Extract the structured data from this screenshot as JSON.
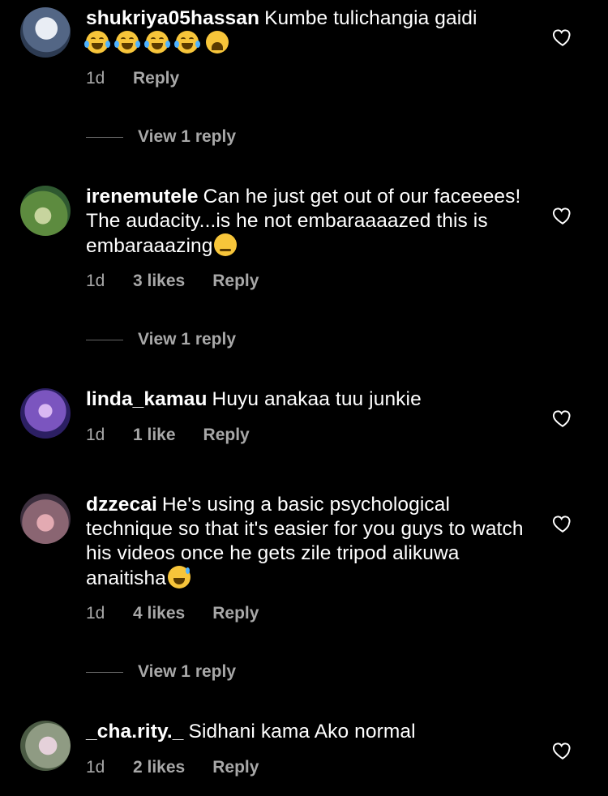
{
  "comments": [
    {
      "username": "shukriya05hassan",
      "text": "Kumbe tulichangia gaidi",
      "emojis": [
        "face-with-tears-of-joy",
        "face-with-tears-of-joy",
        "face-with-tears-of-joy",
        "face-with-tears-of-joy",
        "weary-face"
      ],
      "time": "1d",
      "likes": "",
      "reply": "Reply",
      "view_replies": "View 1 reply",
      "avatar_colors": [
        "#4a5b7b",
        "#c9d4e2"
      ]
    },
    {
      "username": "irenemutele",
      "text": "Can he just get out of our faceeees! The audacity...is he not embaraaaazed this is embaraaazing",
      "emojis": [
        "unamused-face"
      ],
      "time": "1d",
      "likes": "3 likes",
      "reply": "Reply",
      "view_replies": "View 1 reply",
      "avatar_colors": [
        "#4f8b3c",
        "#d7e7a9"
      ]
    },
    {
      "username": "linda_kamau",
      "text": "Huyu anakaa tuu junkie",
      "emojis": [],
      "time": "1d",
      "likes": "1 like",
      "reply": "Reply",
      "view_replies": "",
      "avatar_colors": [
        "#3d2d86",
        "#b18be7"
      ]
    },
    {
      "username": "dzzecai",
      "text": "He's using a basic psychological technique so that it's easier for you guys to watch his videos once he gets zile tripod alikuwa anaitisha",
      "emojis": [
        "grinning-face-with-sweat"
      ],
      "time": "1d",
      "likes": "4 likes",
      "reply": "Reply",
      "view_replies": "View 1 reply",
      "avatar_colors": [
        "#6d5972",
        "#d49da3"
      ]
    },
    {
      "username": "_cha.rity._",
      "text": "Sidhani kama Ako normal",
      "emojis": [],
      "time": "1d",
      "likes": "2 likes",
      "reply": "Reply",
      "view_replies": "",
      "avatar_colors": [
        "#6b7d5b",
        "#d7c3cf"
      ]
    }
  ],
  "colors": {
    "background": "#000000",
    "text_primary": "#ffffff",
    "text_secondary": "#a8a8a8",
    "emoji_yellow": "#f7c53a"
  }
}
